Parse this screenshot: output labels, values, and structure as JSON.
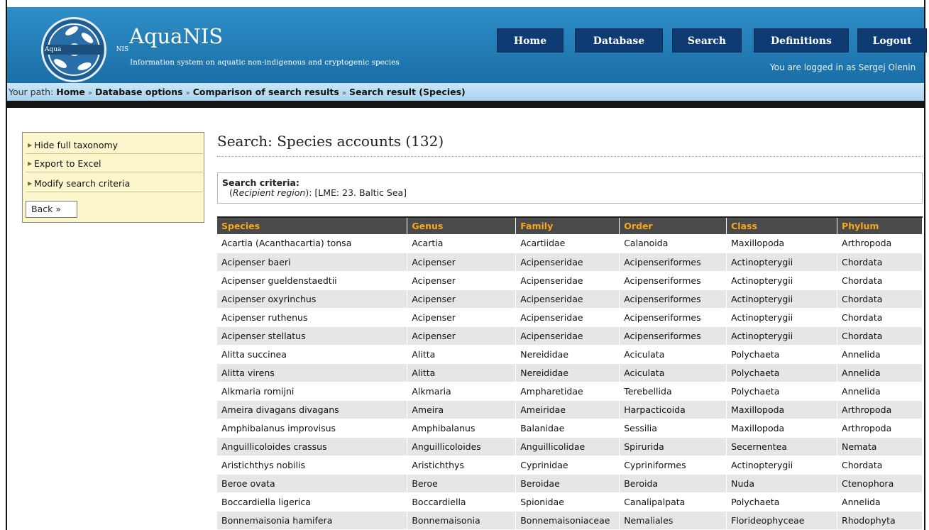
{
  "header": {
    "title": "AquaNIS",
    "subtitle": "Information system on aquatic non-indigenous and cryptogenic species",
    "logo_text_left": "Aqua",
    "logo_text_right": "NIS",
    "logged_in": "You are logged in as Sergej Olenin"
  },
  "nav": {
    "home": "Home",
    "database": "Database",
    "search": "Search",
    "definitions": "Definitions",
    "logout": "Logout"
  },
  "path": {
    "label": "Your path:",
    "items": [
      "Home",
      "Database options",
      "Comparison of search results",
      "Search result (Species)"
    ],
    "separator": "»"
  },
  "sidebar": {
    "items": [
      {
        "label": "Hide full taxonomy"
      },
      {
        "label": "Export to Excel"
      },
      {
        "label": "Modify search criteria"
      }
    ],
    "back_label": "Back »"
  },
  "main": {
    "title": "Search: Species accounts (132)",
    "criteria_label": "Search criteria:",
    "criteria_field": "Recipient region",
    "criteria_value": ": [LME: 23. Baltic Sea]"
  },
  "table": {
    "columns": [
      "Species",
      "Genus",
      "Family",
      "Order",
      "Class",
      "Phylum"
    ],
    "rows": [
      [
        "Acartia (Acanthacartia) tonsa",
        "Acartia",
        "Acartiidae",
        "Calanoida",
        "Maxillopoda",
        "Arthropoda"
      ],
      [
        "Acipenser baeri",
        "Acipenser",
        "Acipenseridae",
        "Acipenseriformes",
        "Actinopterygii",
        "Chordata"
      ],
      [
        "Acipenser gueldenstaedtii",
        "Acipenser",
        "Acipenseridae",
        "Acipenseriformes",
        "Actinopterygii",
        "Chordata"
      ],
      [
        "Acipenser oxyrinchus",
        "Acipenser",
        "Acipenseridae",
        "Acipenseriformes",
        "Actinopterygii",
        "Chordata"
      ],
      [
        "Acipenser ruthenus",
        "Acipenser",
        "Acipenseridae",
        "Acipenseriformes",
        "Actinopterygii",
        "Chordata"
      ],
      [
        "Acipenser stellatus",
        "Acipenser",
        "Acipenseridae",
        "Acipenseriformes",
        "Actinopterygii",
        "Chordata"
      ],
      [
        "Alitta succinea",
        "Alitta",
        "Nereididae",
        "Aciculata",
        "Polychaeta",
        "Annelida"
      ],
      [
        "Alitta virens",
        "Alitta",
        "Nereididae",
        "Aciculata",
        "Polychaeta",
        "Annelida"
      ],
      [
        "Alkmaria romijni",
        "Alkmaria",
        "Ampharetidae",
        "Terebellida",
        "Polychaeta",
        "Annelida"
      ],
      [
        "Ameira divagans divagans",
        "Ameira",
        "Ameiridae",
        "Harpacticoida",
        "Maxillopoda",
        "Arthropoda"
      ],
      [
        "Amphibalanus improvisus",
        "Amphibalanus",
        "Balanidae",
        "Sessilia",
        "Maxillopoda",
        "Arthropoda"
      ],
      [
        "Anguillicoloides crassus",
        "Anguillicoloides",
        "Anguillicolidae",
        "Spirurida",
        "Secernentea",
        "Nemata"
      ],
      [
        "Aristichthys nobilis",
        "Aristichthys",
        "Cyprinidae",
        "Cypriniformes",
        "Actinopterygii",
        "Chordata"
      ],
      [
        "Beroe ovata",
        "Beroe",
        "Beroidae",
        "Beroida",
        "Nuda",
        "Ctenophora"
      ],
      [
        "Boccardiella ligerica",
        "Boccardiella",
        "Spionidae",
        "Canalipalpata",
        "Polychaeta",
        "Annelida"
      ],
      [
        "Bonnemaisonia hamifera",
        "Bonnemaisonia",
        "Bonnemaisoniaceae",
        "Nemaliales",
        "Florideophyceae",
        "Rhodophyta"
      ]
    ]
  },
  "colors": {
    "header_blue": "#1a6ea6",
    "nav_navy": "#0f3b73",
    "table_header_bg": "#4a4a4a",
    "table_header_text": "#f7a81b",
    "sidebar_bg": "#fcf6cc"
  }
}
